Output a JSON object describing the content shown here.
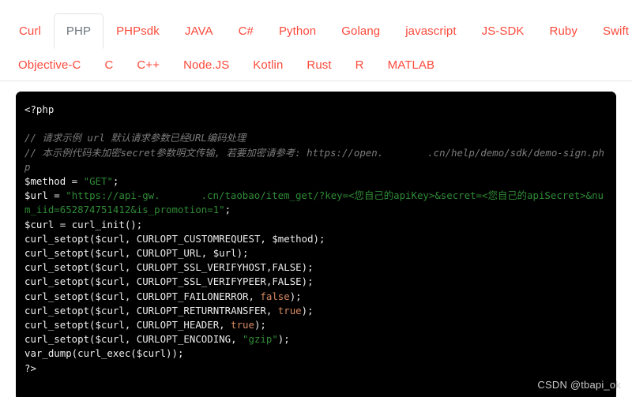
{
  "tabs": {
    "row1": [
      {
        "label": "Curl",
        "active": false
      },
      {
        "label": "PHP",
        "active": true
      },
      {
        "label": "PHPsdk",
        "active": false
      },
      {
        "label": "JAVA",
        "active": false
      },
      {
        "label": "C#",
        "active": false
      },
      {
        "label": "Python",
        "active": false
      },
      {
        "label": "Golang",
        "active": false
      },
      {
        "label": "javascript",
        "active": false
      },
      {
        "label": "JS-SDK",
        "active": false
      },
      {
        "label": "Ruby",
        "active": false
      },
      {
        "label": "Swift",
        "active": false
      }
    ],
    "row2": [
      {
        "label": "Objective-C",
        "active": false
      },
      {
        "label": "C",
        "active": false
      },
      {
        "label": "C++",
        "active": false
      },
      {
        "label": "Node.JS",
        "active": false
      },
      {
        "label": "Kotlin",
        "active": false
      },
      {
        "label": "Rust",
        "active": false
      },
      {
        "label": "R",
        "active": false
      },
      {
        "label": "MATLAB",
        "active": false
      }
    ],
    "colors": {
      "inactive_text": "#fb4a3b",
      "active_text": "#6c757d",
      "active_border": "#e3e3e3",
      "bar_border": "#e8e8e8"
    }
  },
  "code": {
    "language": "PHP",
    "background": "#000000",
    "colors": {
      "text": "#e8e8e8",
      "comment": "#7c7c7c",
      "string": "#2f8a36",
      "keyword": "#d98a62"
    },
    "open_tag": "<?php",
    "close_tag": "?>",
    "comment_1": "// 请求示例 url 默认请求参数已经URL编码处理",
    "comment_2_a": "// 本示例代码未加密secret参数明文传输, 若要加密请参考: https://open.",
    "comment_2_b": ".cn/help/demo/sdk/demo-sign.php",
    "method_var": "$method",
    "method_value": "\"GET\"",
    "url_var": "$url",
    "url_part_a": "\"https://api-gw.",
    "url_part_b": ".cn/taobao/item_get/?key=<您自己的apiKey>&secret=<您自己的apiSecret>&num_iid=652874751412&is_promotion=1\"",
    "num_iid": "652874751412",
    "is_promotion": "1",
    "curl_var": "$curl",
    "curl_init": "curl_init();",
    "lines": [
      {
        "fn": "curl_setopt(",
        "args_plain": "$curl, CURLOPT_CUSTOMREQUEST, $method",
        "kw": "",
        "tail": ");"
      },
      {
        "fn": "curl_setopt(",
        "args_plain": "$curl, CURLOPT_URL, $url",
        "kw": "",
        "tail": ");"
      },
      {
        "fn": "curl_setopt(",
        "args_plain": "$curl, CURLOPT_SSL_VERIFYHOST,FALSE",
        "kw": "",
        "tail": ");"
      },
      {
        "fn": "curl_setopt(",
        "args_plain": "$curl, CURLOPT_SSL_VERIFYPEER,FALSE",
        "kw": "",
        "tail": ");"
      },
      {
        "fn": "curl_setopt(",
        "args_plain": "$curl, CURLOPT_FAILONERROR, ",
        "kw": "false",
        "tail": ");"
      },
      {
        "fn": "curl_setopt(",
        "args_plain": "$curl, CURLOPT_RETURNTRANSFER, ",
        "kw": "true",
        "tail": ");"
      },
      {
        "fn": "curl_setopt(",
        "args_plain": "$curl, CURLOPT_HEADER, ",
        "kw": "true",
        "tail": ");"
      },
      {
        "fn": "curl_setopt(",
        "args_plain": "$curl, CURLOPT_ENCODING, ",
        "kw": "\"gzip\"",
        "kw_is_string": true,
        "tail": ");"
      }
    ],
    "var_dump_line": "var_dump(curl_exec($curl));"
  },
  "watermark": {
    "text": "CSDN @tbapi_ok"
  }
}
